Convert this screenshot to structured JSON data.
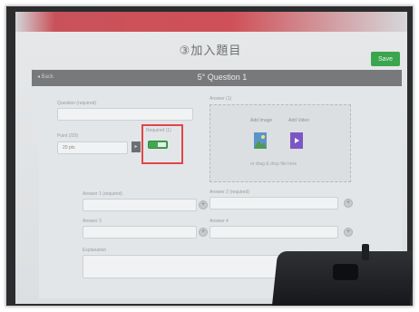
{
  "page": {
    "heading": "③加入題目",
    "save_label": "Save",
    "back_label": "◂ Back",
    "question_title": "5° Question 1"
  },
  "form": {
    "question_label": "Question (required)",
    "points_label": "Point (/20)",
    "points_value": "20 pts",
    "answer_label": "Answer (1)",
    "required_toggle_label": "Required (1)",
    "required_toggle_on": true,
    "answer_a_label": "Answer 1 (required)",
    "answer_b_label": "Answer 2 (required)",
    "answer_c_label": "Answer 3",
    "answer_d_label": "Answer 4",
    "explanation_label": "Explanation",
    "add_symbol": "+"
  },
  "media": {
    "image_label": "Add Image",
    "video_label": "Add Video",
    "hint": "or drag & drop file here"
  },
  "colors": {
    "accent_green": "#3aa54d",
    "highlight_red": "#e0454a",
    "header_red": "#cf5058"
  }
}
